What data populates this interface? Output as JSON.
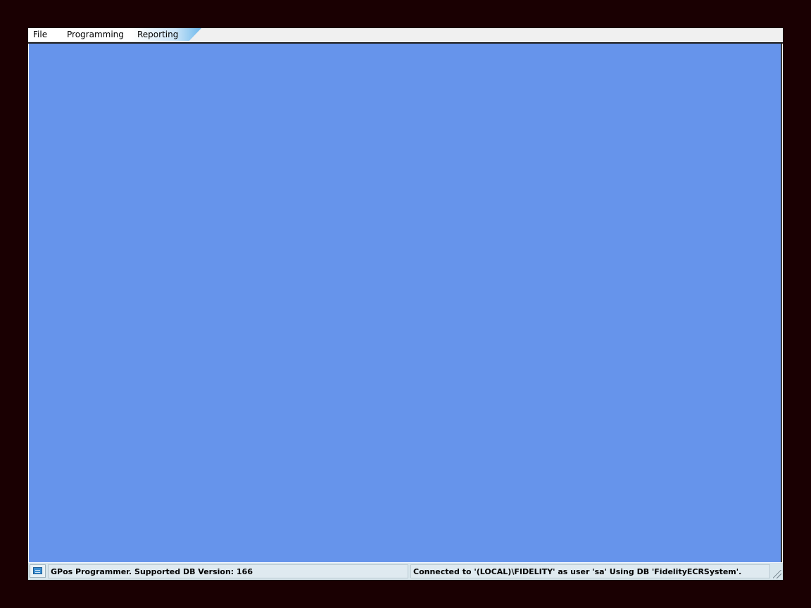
{
  "menubar": {
    "items": [
      {
        "label": "File"
      },
      {
        "label": "Programming"
      },
      {
        "label": "Reporting"
      }
    ]
  },
  "statusbar": {
    "icon": "keyboard-icon",
    "left_text": "GPos Programmer. Supported DB Version: 166",
    "right_text": "Connected to '(LOCAL)\\FIDELITY' as user 'sa' Using DB 'FidelityECRSystem'."
  },
  "colors": {
    "background": "#1a0002",
    "workspace": "#6694eb",
    "statusbar": "#d8e6ec",
    "menu_accent": "#6fb9ec"
  }
}
